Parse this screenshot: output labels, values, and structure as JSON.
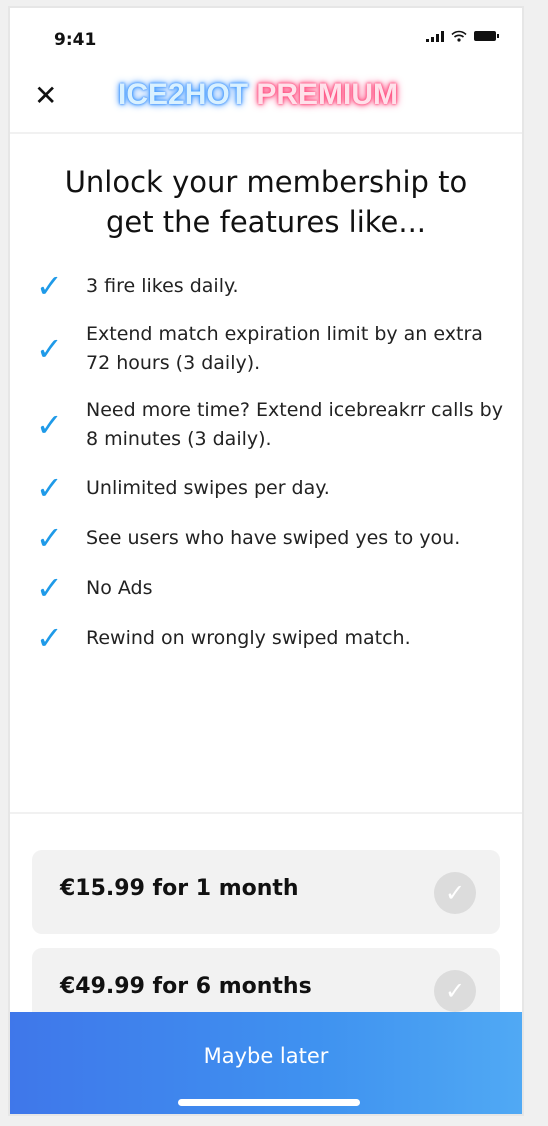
{
  "status": {
    "time": "9:41"
  },
  "header": {
    "close_icon": "close-icon",
    "brand_part1": "ICE2HOT",
    "brand_part2": "PREMIUM",
    "brand_colors": {
      "ice": "#4aa8ff",
      "hot": "#ff3c72"
    }
  },
  "main": {
    "title_line1": "Unlock your membership to",
    "title_line2": "get the features like...",
    "features": [
      {
        "text": "3 fire likes daily."
      },
      {
        "text": "Extend match expiration limit by an extra 72 hours (3 daily)."
      },
      {
        "text": "Need more time? Extend icebreakrr calls by 8 minutes (3 daily)."
      },
      {
        "text": "Unlimited swipes per day."
      },
      {
        "text": "See users who have swiped yes to you."
      },
      {
        "text": "No Ads"
      },
      {
        "text": "Rewind on wrongly swiped match."
      }
    ],
    "plans": [
      {
        "label": "€15.99 for 1 month"
      },
      {
        "label": "€49.99 for 6 months"
      }
    ]
  },
  "footer": {
    "maybe_later": "Maybe later"
  }
}
